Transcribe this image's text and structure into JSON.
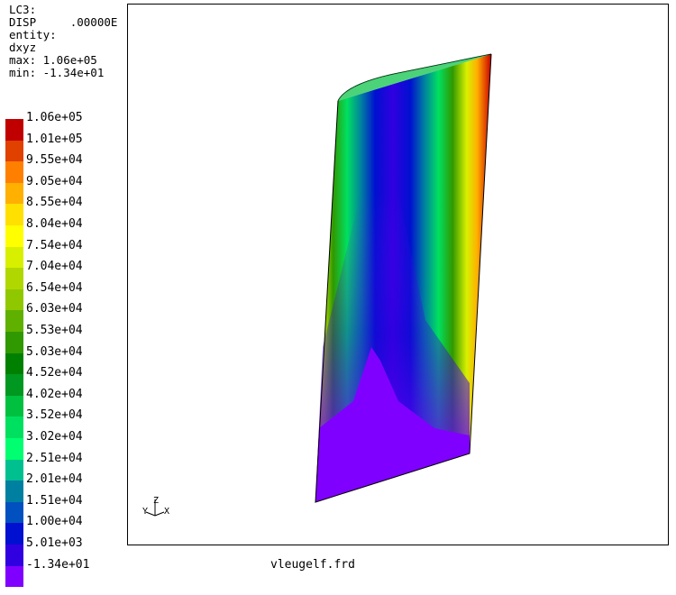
{
  "info": {
    "loadcase": "LC3:",
    "disp": "DISP     .00000E",
    "entity": "entity:",
    "component": "dxyz",
    "max": "max: 1.06e+05",
    "min": "min: -1.34e+01"
  },
  "legend": [
    {
      "label": "1.06e+05",
      "color": "#c00000"
    },
    {
      "label": "1.01e+05",
      "color": "#e04000"
    },
    {
      "label": "9.55e+04",
      "color": "#ff8000"
    },
    {
      "label": "9.05e+04",
      "color": "#ffb000"
    },
    {
      "label": "8.55e+04",
      "color": "#ffe000"
    },
    {
      "label": "8.04e+04",
      "color": "#ffff00"
    },
    {
      "label": "7.54e+04",
      "color": "#d8f000"
    },
    {
      "label": "7.04e+04",
      "color": "#b0d800"
    },
    {
      "label": "6.54e+04",
      "color": "#90c800"
    },
    {
      "label": "6.03e+04",
      "color": "#60b000"
    },
    {
      "label": "5.53e+04",
      "color": "#309800"
    },
    {
      "label": "5.03e+04",
      "color": "#008000"
    },
    {
      "label": "4.52e+04",
      "color": "#009820"
    },
    {
      "label": "4.02e+04",
      "color": "#00c040"
    },
    {
      "label": "3.52e+04",
      "color": "#00e060"
    },
    {
      "label": "3.02e+04",
      "color": "#00ff70"
    },
    {
      "label": "2.51e+04",
      "color": "#00c090"
    },
    {
      "label": "2.01e+04",
      "color": "#0080a0"
    },
    {
      "label": "1.51e+04",
      "color": "#0050c0"
    },
    {
      "label": "1.00e+04",
      "color": "#0010d0"
    },
    {
      "label": "5.01e+03",
      "color": "#3000e0"
    },
    {
      "label": "-1.34e+01",
      "color": "#8000ff"
    }
  ],
  "axes_triad": "Y Z X",
  "filename": "vleugelf.frd"
}
